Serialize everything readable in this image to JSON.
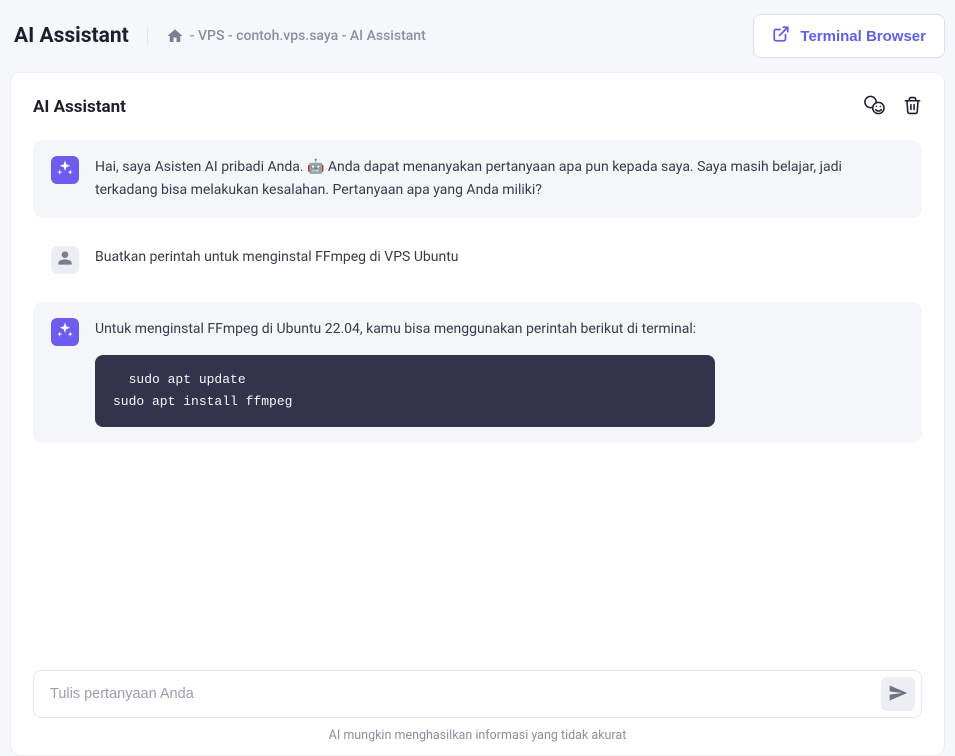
{
  "header": {
    "title": "AI Assistant",
    "breadcrumb": " - VPS - contoh.vps.saya - AI Assistant",
    "terminal_button": "Terminal Browser"
  },
  "card": {
    "title": "AI Assistant"
  },
  "messages": {
    "assistant_intro": "Hai, saya Asisten AI pribadi Anda. 🤖 Anda dapat menanyakan pertanyaan apa pun kepada saya. Saya masih belajar, jadi terkadang bisa melakukan kesalahan. Pertanyaan apa yang Anda miliki?",
    "user_query": "Buatkan perintah untuk menginstal FFmpeg di VPS Ubuntu",
    "assistant_reply": "Untuk menginstal FFmpeg di Ubuntu 22.04, kamu bisa menggunakan perintah berikut di terminal:",
    "code": "  sudo apt update\nsudo apt install ffmpeg"
  },
  "input": {
    "placeholder": "Tulis pertanyaan Anda"
  },
  "footer": {
    "note": "AI mungkin menghasilkan informasi yang tidak akurat"
  }
}
